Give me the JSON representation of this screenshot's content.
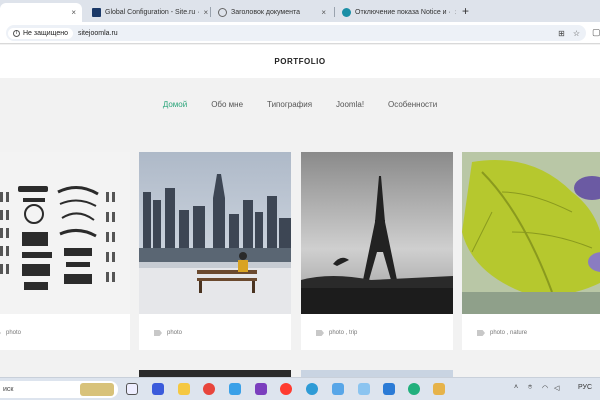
{
  "tabs": [
    {
      "label": "",
      "active": true
    },
    {
      "label": "Global Configuration - Site.ru ·",
      "active": false
    },
    {
      "label": "Заголовок документа",
      "active": false
    },
    {
      "label": "Отключение показа Notice и ·",
      "active": false
    }
  ],
  "tab_close": "×",
  "new_tab": "+",
  "address": {
    "security_label": "Не защищено",
    "url": "sitejoomla.ru"
  },
  "site": {
    "logo": "PORTFOLIO"
  },
  "menu": [
    {
      "label": "Домой",
      "active": true
    },
    {
      "label": "Обо мне",
      "active": false
    },
    {
      "label": "Типография",
      "active": false
    },
    {
      "label": "Joomla!",
      "active": false
    },
    {
      "label": "Особенности",
      "active": false
    }
  ],
  "cards": [
    {
      "tags": "photo",
      "image": "typewriter-parts"
    },
    {
      "tags": "photo",
      "image": "city-skyline"
    },
    {
      "tags": "photo , trip",
      "image": "eiffel-tower"
    },
    {
      "tags": "photo , nature",
      "image": "green-leaf"
    }
  ],
  "taskbar": {
    "search_text": "иск",
    "lang": "РУС"
  },
  "colors": {
    "accent": "#2aa57a"
  }
}
